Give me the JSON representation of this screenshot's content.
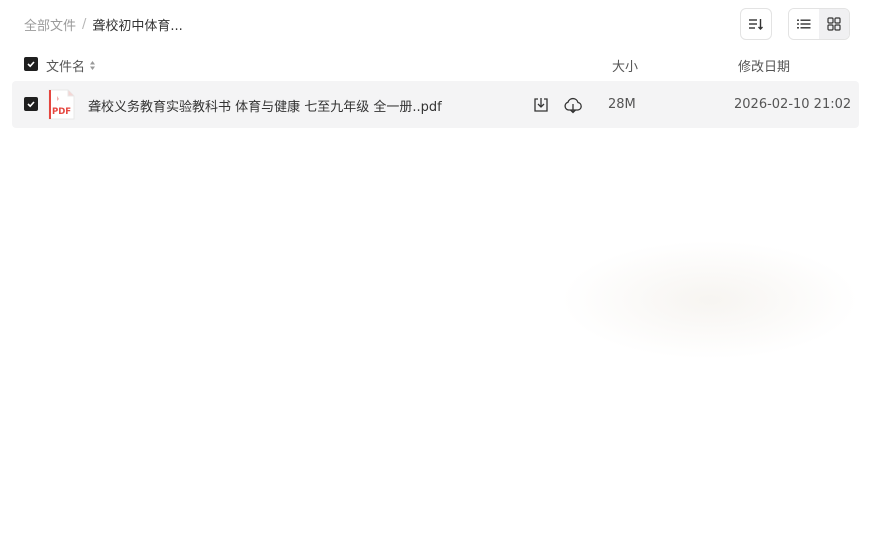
{
  "breadcrumb": {
    "root": "全部文件",
    "separator": "/",
    "current": "聋校初中体育..."
  },
  "toolbar": {
    "sort_icon": "sort-lines-icon",
    "view_list_icon": "list-view-icon",
    "view_grid_icon": "grid-view-icon"
  },
  "table": {
    "columns": {
      "name": "文件名",
      "size": "大小",
      "date": "修改日期"
    },
    "rows": [
      {
        "name": "聋校义务教育实验教科书 体育与健康 七至九年级 全一册..pdf",
        "file_type_label": "PDF",
        "size": "28M",
        "date": "2026-02-10 21:02",
        "checked": true
      }
    ]
  },
  "colors": {
    "checkbox": "#1f1f1f",
    "pdf_red": "#e5463f",
    "row_bg": "#f4f4f5"
  }
}
